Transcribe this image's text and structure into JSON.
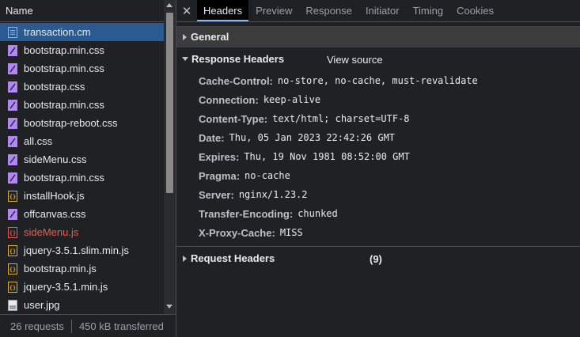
{
  "list": {
    "header": "Name",
    "items": [
      {
        "name": "transaction.cm",
        "type": "doc",
        "selected": true,
        "error": false
      },
      {
        "name": "bootstrap.min.css",
        "type": "css",
        "selected": false,
        "error": false
      },
      {
        "name": "bootstrap.min.css",
        "type": "css",
        "selected": false,
        "error": false
      },
      {
        "name": "bootstrap.css",
        "type": "css",
        "selected": false,
        "error": false
      },
      {
        "name": "bootstrap.min.css",
        "type": "css",
        "selected": false,
        "error": false
      },
      {
        "name": "bootstrap-reboot.css",
        "type": "css",
        "selected": false,
        "error": false
      },
      {
        "name": "all.css",
        "type": "css",
        "selected": false,
        "error": false
      },
      {
        "name": "sideMenu.css",
        "type": "css",
        "selected": false,
        "error": false
      },
      {
        "name": "bootstrap.min.css",
        "type": "css",
        "selected": false,
        "error": false
      },
      {
        "name": "installHook.js",
        "type": "js",
        "selected": false,
        "error": false
      },
      {
        "name": "offcanvas.css",
        "type": "css",
        "selected": false,
        "error": false
      },
      {
        "name": "sideMenu.js",
        "type": "js-error",
        "selected": false,
        "error": true
      },
      {
        "name": "jquery-3.5.1.slim.min.js",
        "type": "js",
        "selected": false,
        "error": false
      },
      {
        "name": "bootstrap.min.js",
        "type": "js",
        "selected": false,
        "error": false
      },
      {
        "name": "jquery-3.5.1.min.js",
        "type": "js",
        "selected": false,
        "error": false
      },
      {
        "name": "user.jpg",
        "type": "img",
        "selected": false,
        "error": false
      }
    ]
  },
  "status": {
    "requests": "26 requests",
    "transferred": "450 kB transferred"
  },
  "tabs": [
    {
      "label": "Headers",
      "active": true
    },
    {
      "label": "Preview",
      "active": false
    },
    {
      "label": "Response",
      "active": false
    },
    {
      "label": "Initiator",
      "active": false
    },
    {
      "label": "Timing",
      "active": false
    },
    {
      "label": "Cookies",
      "active": false
    }
  ],
  "sections": {
    "general": "General",
    "response": "Response Headers",
    "view_source": "View source",
    "request": "Request Headers",
    "request_count": "(9)"
  },
  "response_headers": [
    {
      "key": "Cache-Control:",
      "value": "no-store, no-cache, must-revalidate"
    },
    {
      "key": "Connection:",
      "value": "keep-alive"
    },
    {
      "key": "Content-Type:",
      "value": "text/html; charset=UTF-8"
    },
    {
      "key": "Date:",
      "value": "Thu, 05 Jan 2023 22:42:26 GMT"
    },
    {
      "key": "Expires:",
      "value": "Thu, 19 Nov 1981 08:52:00 GMT"
    },
    {
      "key": "Pragma:",
      "value": "no-cache"
    },
    {
      "key": "Server:",
      "value": "nginx/1.23.2"
    },
    {
      "key": "Transfer-Encoding:",
      "value": "chunked"
    },
    {
      "key": "X-Proxy-Cache:",
      "value": "MISS"
    }
  ],
  "colors": {
    "css_icon": "#b186f5",
    "js_icon": "#e1b12c",
    "js_error_icon": "#f1594c",
    "doc_icon": "#8ab4f8",
    "selected_row": "#2a5a90",
    "active_tab_underline": "#8ab4f8"
  }
}
